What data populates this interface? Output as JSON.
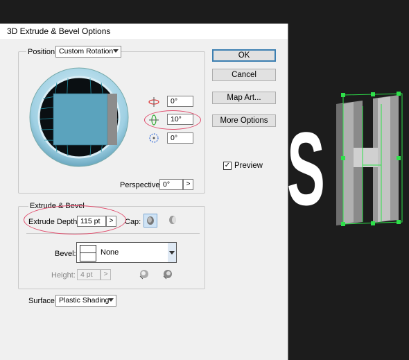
{
  "dialog": {
    "title": "3D Extrude & Bevel Options"
  },
  "position": {
    "legend": "Position:",
    "preset": "Custom Rotation",
    "rot_x": "0°",
    "rot_y": "10°",
    "rot_z": "0°",
    "perspective_label": "Perspective:",
    "perspective_value": "0°",
    "perspective_arrow": ">"
  },
  "buttons": {
    "ok": "OK",
    "cancel": "Cancel",
    "map_art": "Map Art...",
    "more_options": "More Options"
  },
  "preview": {
    "label": "Preview",
    "checked": true,
    "check_glyph": "✓"
  },
  "extrude": {
    "legend": "Extrude & Bevel",
    "depth_label": "Extrude Depth:",
    "depth_value": "115 pt",
    "depth_arrow": ">",
    "cap_label": "Cap:",
    "bevel_label": "Bevel:",
    "bevel_value": "None",
    "height_label": "Height:",
    "height_value": "4 pt",
    "height_arrow": ">"
  },
  "surface": {
    "label": "Surface:",
    "value": "Plastic Shading"
  },
  "canvas": {
    "letters": "SH"
  },
  "colors": {
    "annotation": "#e04a6a",
    "selection": "#2ee04a",
    "accent": "#3c7fb1"
  }
}
